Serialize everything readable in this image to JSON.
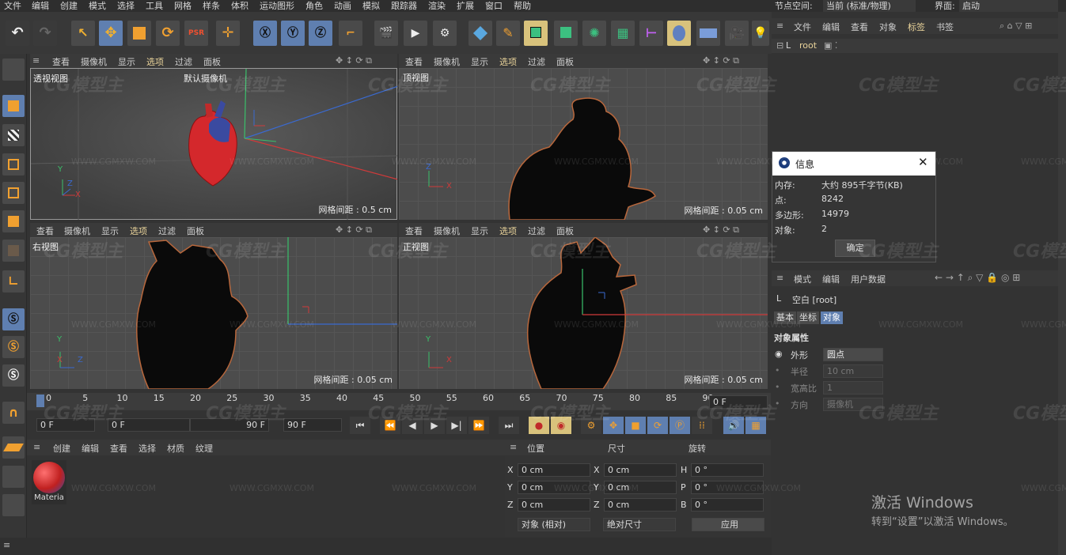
{
  "menu": [
    "文件",
    "编辑",
    "创建",
    "模式",
    "选择",
    "工具",
    "网格",
    "样条",
    "体积",
    "运动图形",
    "角色",
    "动画",
    "模拟",
    "跟踪器",
    "渲染",
    "扩展",
    "窗口",
    "帮助"
  ],
  "menu_right": {
    "node_space_label": "节点空间:",
    "node_space_value": "当前 (标准/物理)",
    "interface_label": "界面:",
    "interface_value": "启动"
  },
  "viewport_menu": [
    "查看",
    "摄像机",
    "显示",
    "选项",
    "过滤",
    "面板"
  ],
  "viewports": {
    "perspective": {
      "name": "透视视图",
      "camera": "默认摄像机",
      "grid": "网格间距 : 0.5 cm"
    },
    "top": {
      "name": "顶视图",
      "grid": "网格间距 : 0.05 cm"
    },
    "right": {
      "name": "右视图",
      "grid": "网格间距 : 0.05 cm"
    },
    "front": {
      "name": "正视图",
      "grid": "网格间距 : 0.05 cm"
    }
  },
  "axis": {
    "x": "X",
    "y": "Y",
    "z": "Z"
  },
  "timeline": {
    "ticks": [
      "0",
      "5",
      "10",
      "15",
      "20",
      "25",
      "30",
      "35",
      "40",
      "45",
      "50",
      "55",
      "60",
      "65",
      "70",
      "75",
      "80",
      "85",
      "90"
    ],
    "current_frame": "0 F"
  },
  "transport": {
    "start": "0 F",
    "range_start": "0 F",
    "range_end": "90 F",
    "end": "90 F"
  },
  "material_menu": [
    "创建",
    "编辑",
    "查看",
    "选择",
    "材质",
    "纹理"
  ],
  "material": {
    "name": "Materia"
  },
  "coords": {
    "headers": [
      "位置",
      "尺寸",
      "旋转"
    ],
    "rows": [
      {
        "axis": "X",
        "pos": "0 cm",
        "size_axis": "X",
        "size": "0 cm",
        "rot_axis": "H",
        "rot": "0 °"
      },
      {
        "axis": "Y",
        "pos": "0 cm",
        "size_axis": "Y",
        "size": "0 cm",
        "rot_axis": "P",
        "rot": "0 °"
      },
      {
        "axis": "Z",
        "pos": "0 cm",
        "size_axis": "Z",
        "size": "0 cm",
        "rot_axis": "B",
        "rot": "0 °"
      }
    ],
    "mode": "对象 (相对)",
    "size_mode": "绝对尺寸",
    "apply": "应用"
  },
  "object_manager": {
    "menu": [
      "文件",
      "编辑",
      "查看",
      "对象",
      "标签",
      "书签"
    ],
    "root": "root"
  },
  "info_dialog": {
    "title": "信息",
    "rows": [
      {
        "label": "内存:",
        "value": "大约 895千字节(KB)"
      },
      {
        "label": "点:",
        "value": "8242"
      },
      {
        "label": "多边形:",
        "value": "14979"
      },
      {
        "label": "对象:",
        "value": "2"
      }
    ],
    "ok": "确定"
  },
  "attribute_manager": {
    "menu": [
      "模式",
      "编辑",
      "用户数据"
    ],
    "object_title": "空白 [root]",
    "tabs": [
      "基本",
      "坐标",
      "对象"
    ],
    "section": "对象属性",
    "props": [
      {
        "label": "外形",
        "value": "圆点"
      },
      {
        "label": "半径",
        "value": "10 cm"
      },
      {
        "label": "宽高比",
        "value": "1"
      },
      {
        "label": "方向",
        "value": "摄像机"
      }
    ]
  },
  "activation": {
    "line1": "激活 Windows",
    "line2": "转到“设置”以激活 Windows。"
  },
  "watermark": {
    "logo": "CG模型主",
    "url": "WWW.CGMXW.COM"
  },
  "colors": {
    "accent": "#5f7fb0",
    "selected_text": "#e9d39a",
    "heart_red": "#d4282c",
    "silhouette": "#0a0a0a"
  }
}
